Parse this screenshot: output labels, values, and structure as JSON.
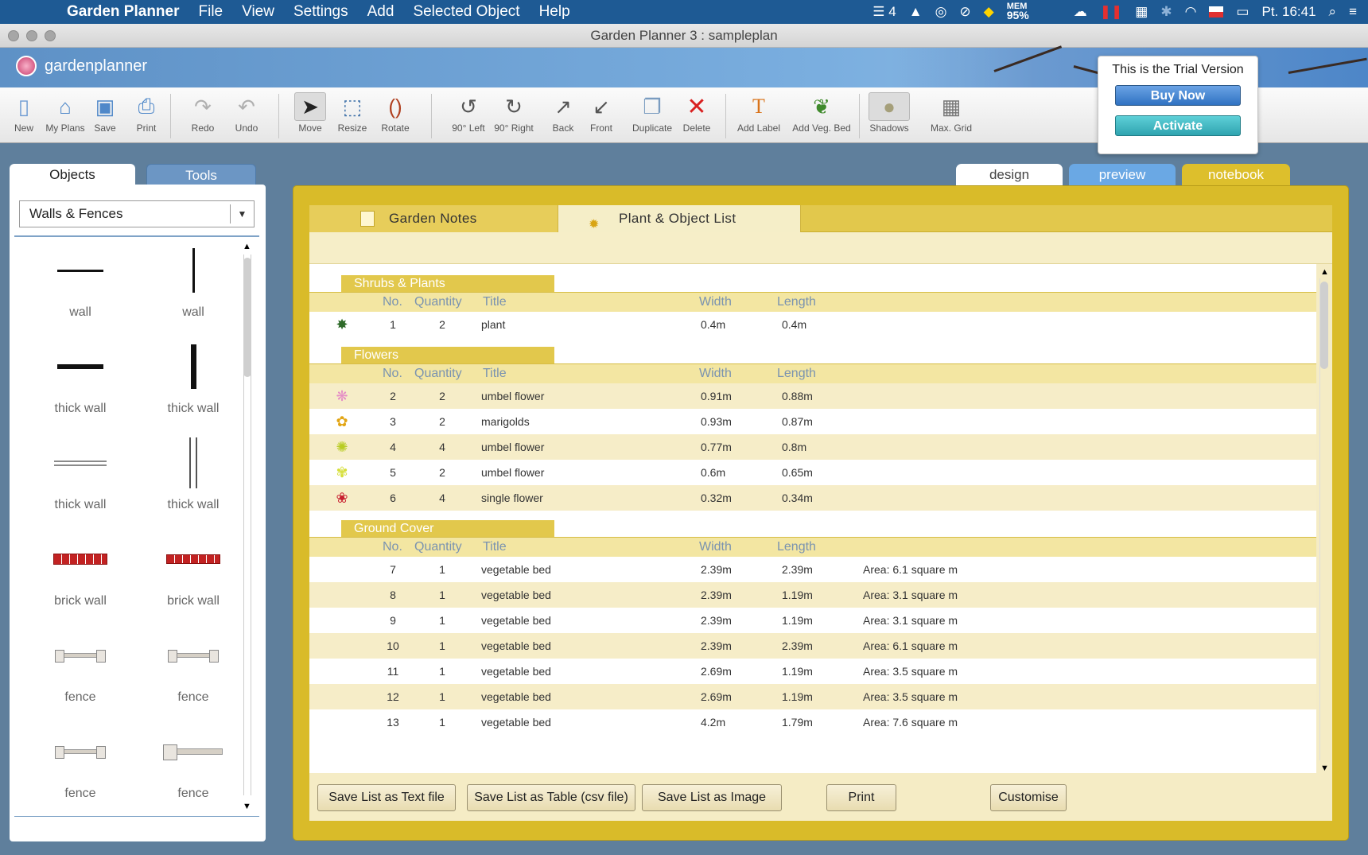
{
  "menubar": {
    "apple": "",
    "items": [
      "Garden Planner",
      "File",
      "View",
      "Settings",
      "Add",
      "Selected Object",
      "Help"
    ],
    "tray": {
      "badge": "4",
      "mem_label": "MEM",
      "mem_value": "95%",
      "clock": "Pt. 16:41"
    }
  },
  "window": {
    "title": "Garden Planner 3 : sampleplan"
  },
  "banner": {
    "logo_text": "gardenplanner"
  },
  "toolbar": {
    "new": "New",
    "my_plans": "My Plans",
    "save": "Save",
    "print": "Print",
    "redo": "Redo",
    "undo": "Undo",
    "move": "Move",
    "resize": "Resize",
    "rotate": "Rotate",
    "rot_left": "90° Left",
    "rot_right": "90° Right",
    "back": "Back",
    "front": "Front",
    "duplicate": "Duplicate",
    "delete": "Delete",
    "add_label": "Add Label",
    "add_veg_bed": "Add Veg. Bed",
    "shadows": "Shadows",
    "max_grid": "Max. Grid"
  },
  "trial": {
    "text": "This is the Trial Version",
    "buy": "Buy Now",
    "activate": "Activate"
  },
  "left_panel": {
    "tabs": {
      "objects": "Objects",
      "tools": "Tools"
    },
    "category": "Walls & Fences",
    "objects": [
      "wall",
      "wall",
      "thick wall",
      "thick wall",
      "thick wall",
      "thick wall",
      "brick wall",
      "brick wall",
      "fence",
      "fence",
      "fence",
      "fence"
    ]
  },
  "view_tabs": {
    "design": "design",
    "preview": "preview",
    "notebook": "notebook"
  },
  "notebook": {
    "tabs": {
      "notes": "Garden Notes",
      "list": "Plant & Object List"
    },
    "columns": {
      "no": "No.",
      "qty": "Quantity",
      "title": "Title",
      "width": "Width",
      "length": "Length"
    },
    "sections": {
      "shrubs": {
        "name": "Shrubs & Plants",
        "rows": [
          {
            "icon": "✸",
            "color": "#2f6b2a",
            "no": "1",
            "qty": "2",
            "title": "plant",
            "width": "0.4m",
            "length": "0.4m",
            "area": ""
          }
        ]
      },
      "flowers": {
        "name": "Flowers",
        "rows": [
          {
            "icon": "❋",
            "color": "#e58cc6",
            "no": "2",
            "qty": "2",
            "title": "umbel flower",
            "width": "0.91m",
            "length": "0.88m",
            "area": ""
          },
          {
            "icon": "✿",
            "color": "#e2a514",
            "no": "3",
            "qty": "2",
            "title": "marigolds",
            "width": "0.93m",
            "length": "0.87m",
            "area": ""
          },
          {
            "icon": "✺",
            "color": "#b8cc24",
            "no": "4",
            "qty": "4",
            "title": "umbel flower",
            "width": "0.77m",
            "length": "0.8m",
            "area": ""
          },
          {
            "icon": "✾",
            "color": "#d6df3a",
            "no": "5",
            "qty": "2",
            "title": "umbel flower",
            "width": "0.6m",
            "length": "0.65m",
            "area": ""
          },
          {
            "icon": "❀",
            "color": "#c81f2f",
            "no": "6",
            "qty": "4",
            "title": "single flower",
            "width": "0.32m",
            "length": "0.34m",
            "area": ""
          }
        ]
      },
      "ground": {
        "name": "Ground Cover",
        "rows": [
          {
            "icon": "",
            "color": "#000",
            "no": "7",
            "qty": "1",
            "title": "vegetable bed",
            "width": "2.39m",
            "length": "2.39m",
            "area": "Area: 6.1 square m"
          },
          {
            "icon": "",
            "color": "#000",
            "no": "8",
            "qty": "1",
            "title": "vegetable bed",
            "width": "2.39m",
            "length": "1.19m",
            "area": "Area: 3.1 square m"
          },
          {
            "icon": "",
            "color": "#000",
            "no": "9",
            "qty": "1",
            "title": "vegetable bed",
            "width": "2.39m",
            "length": "1.19m",
            "area": "Area: 3.1 square m"
          },
          {
            "icon": "",
            "color": "#000",
            "no": "10",
            "qty": "1",
            "title": "vegetable bed",
            "width": "2.39m",
            "length": "2.39m",
            "area": "Area: 6.1 square m"
          },
          {
            "icon": "",
            "color": "#000",
            "no": "11",
            "qty": "1",
            "title": "vegetable bed",
            "width": "2.69m",
            "length": "1.19m",
            "area": "Area: 3.5 square m"
          },
          {
            "icon": "",
            "color": "#000",
            "no": "12",
            "qty": "1",
            "title": "vegetable bed",
            "width": "2.69m",
            "length": "1.19m",
            "area": "Area: 3.5 square m"
          },
          {
            "icon": "",
            "color": "#000",
            "no": "13",
            "qty": "1",
            "title": "vegetable bed",
            "width": "4.2m",
            "length": "1.79m",
            "area": "Area: 7.6 square m"
          }
        ]
      }
    },
    "buttons": {
      "save_text": "Save List as Text file",
      "save_csv": "Save List as Table (csv file)",
      "save_image": "Save List as Image",
      "print": "Print",
      "customise": "Customise"
    }
  }
}
